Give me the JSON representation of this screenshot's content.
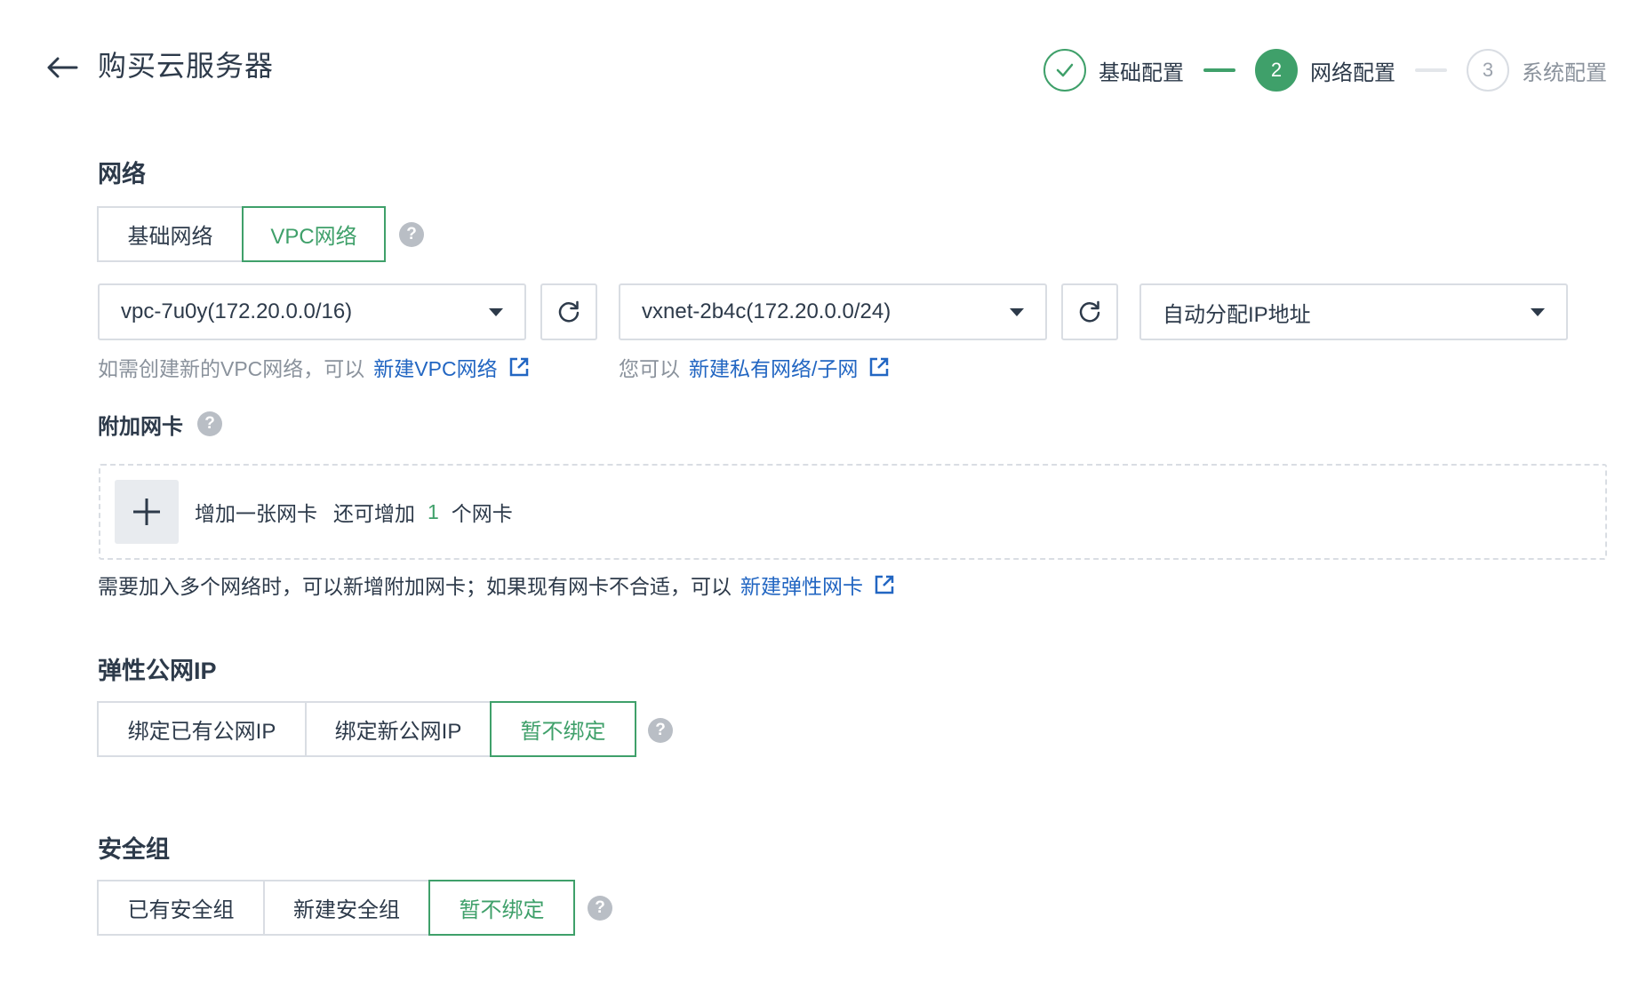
{
  "header": {
    "title": "购买云服务器",
    "steps": [
      {
        "number": "1",
        "label": "基础配置",
        "state": "done"
      },
      {
        "number": "2",
        "label": "网络配置",
        "state": "active"
      },
      {
        "number": "3",
        "label": "系统配置",
        "state": "todo"
      }
    ]
  },
  "network": {
    "title": "网络",
    "types": [
      "基础网络",
      "VPC网络"
    ],
    "selected_type": "VPC网络",
    "vpc_select": {
      "value": "vpc-7u0y(172.20.0.0/16)"
    },
    "vxnet_select": {
      "value": "vxnet-2b4c(172.20.0.0/24)"
    },
    "ip_select": {
      "value": "自动分配IP地址"
    },
    "vpc_hint": "如需创建新的VPC网络，可以",
    "vpc_link": "新建VPC网络",
    "vxnet_hint": "您可以",
    "vxnet_link": "新建私有网络/子网"
  },
  "nic": {
    "title": "附加网卡",
    "add_label": "增加一张网卡",
    "remaining_prefix": "还可增加",
    "remaining_count": "1",
    "remaining_suffix": "个网卡",
    "hint": "需要加入多个网络时，可以新增附加网卡；如果现有网卡不合适，可以",
    "link": "新建弹性网卡"
  },
  "eip": {
    "title": "弹性公网IP",
    "options": [
      "绑定已有公网IP",
      "绑定新公网IP",
      "暂不绑定"
    ],
    "selected": "暂不绑定"
  },
  "security_group": {
    "title": "安全组",
    "options": [
      "已有安全组",
      "新建安全组",
      "暂不绑定"
    ],
    "selected": "暂不绑定"
  },
  "colors": {
    "accent": "#3fa06a",
    "link": "#2266c2",
    "border": "#d9dde3",
    "muted_text": "#8a929c"
  },
  "icons": [
    "arrow-left-icon",
    "check-icon",
    "help-icon",
    "refresh-icon",
    "caret-down-icon",
    "external-link-icon",
    "plus-icon"
  ]
}
